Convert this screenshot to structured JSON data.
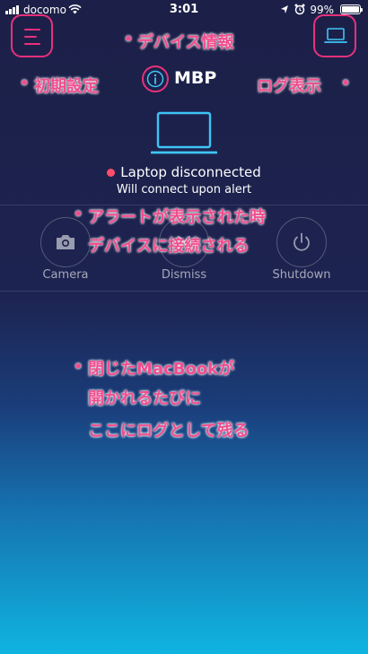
{
  "status_bar": {
    "carrier": "docomo",
    "time": "3:01",
    "battery": "99%",
    "battery_fraction": 0.99
  },
  "device": {
    "name": "MBP",
    "status": "Laptop disconnected",
    "substatus": "Will connect upon alert"
  },
  "actions": {
    "camera": "Camera",
    "dismiss": "Dismiss",
    "shutdown": "Shutdown"
  },
  "annotations": {
    "device_info": "デバイス情報",
    "initial_settings": "初期設定",
    "log_display": "ログ表示",
    "alert_line1": "アラートが表示された時",
    "alert_line2": "デバイスに接続される",
    "log_line1": "閉じたMacBookが",
    "log_line2": "開かれるたびに",
    "log_line3": "ここにログとして残る",
    "bullet": "•"
  },
  "colors": {
    "accent": "#3ec5f5",
    "annotation": "#f24d8e",
    "disconnected": "#ff4d6a"
  }
}
